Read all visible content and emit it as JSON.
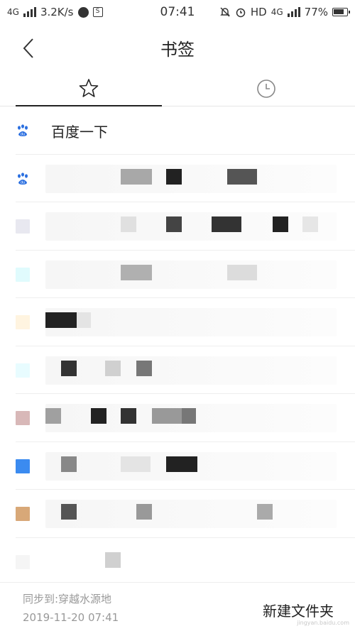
{
  "status_bar": {
    "network": "4G",
    "speed": "3.2K/s",
    "time": "07:41",
    "hd": "HD",
    "network_right": "4G",
    "battery": "77%",
    "sq_glyph": "S"
  },
  "header": {
    "title": "书签"
  },
  "tabs": [
    {
      "name": "bookmarks",
      "icon": "star-icon",
      "active": true
    },
    {
      "name": "history",
      "icon": "clock-icon",
      "active": false
    }
  ],
  "bookmarks": [
    {
      "label": "百度一下",
      "favicon": "baidu-paw-icon",
      "blurred": false
    },
    {
      "label": "",
      "favicon": "baidu-paw-icon",
      "blurred": true
    },
    {
      "label": "",
      "favicon_color": "#e8e8f0",
      "blurred": true
    },
    {
      "label": "",
      "favicon_color": "#e0fbfd",
      "blurred": true
    },
    {
      "label": "",
      "favicon_color": "#fff4e0",
      "blurred": true
    },
    {
      "label": "",
      "favicon_color": "#e8fcff",
      "blurred": true
    },
    {
      "label": "",
      "favicon_color": "#d8b8b8",
      "blurred": true
    },
    {
      "label": "",
      "favicon_color": "#3b8bf0",
      "blurred": true
    },
    {
      "label": "",
      "favicon_color": "#d8a878",
      "blurred": true
    },
    {
      "label": "",
      "favicon_color": "#f5f5f5",
      "blurred": true
    }
  ],
  "footer": {
    "sync_label": "同步到:穿越水源地",
    "sync_time": "2019-11-20 07:41",
    "new_folder": "新建文件夹",
    "watermark": "jingyan.baidu.com"
  },
  "colors": {
    "baidu_blue": "#2b6fe0",
    "text": "#222222",
    "muted": "#999999"
  }
}
